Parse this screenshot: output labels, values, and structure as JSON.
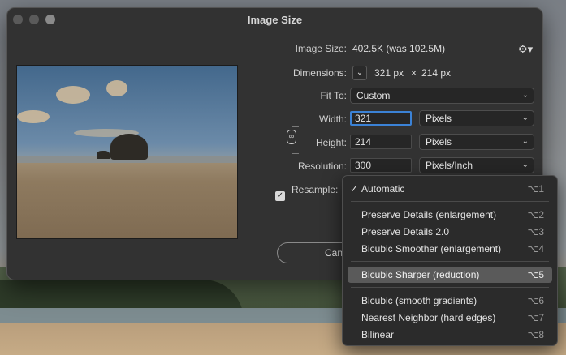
{
  "window": {
    "title": "Image Size"
  },
  "info": {
    "image_size_label": "Image Size:",
    "image_size_value": "402.5K (was 102.5M)",
    "dimensions_label": "Dimensions:",
    "dimensions_width": "321 px",
    "dimensions_times": "×",
    "dimensions_height": "214 px"
  },
  "fit_to": {
    "label": "Fit To:",
    "value": "Custom"
  },
  "width": {
    "label": "Width:",
    "value": "321",
    "unit": "Pixels"
  },
  "height": {
    "label": "Height:",
    "value": "214",
    "unit": "Pixels"
  },
  "resolution": {
    "label": "Resolution:",
    "value": "300",
    "unit": "Pixels/Inch"
  },
  "resample": {
    "label": "Resample:",
    "checked": true
  },
  "buttons": {
    "cancel_label": "Cancel"
  },
  "menu": {
    "items": [
      {
        "label": "Automatic",
        "shortcut": "⌥1",
        "checked": true
      },
      {
        "label": "Preserve Details (enlargement)",
        "shortcut": "⌥2"
      },
      {
        "label": "Preserve Details 2.0",
        "shortcut": "⌥3"
      },
      {
        "label": "Bicubic Smoother (enlargement)",
        "shortcut": "⌥4"
      },
      {
        "label": "Bicubic Sharper (reduction)",
        "shortcut": "⌥5",
        "highlighted": true
      },
      {
        "label": "Bicubic (smooth gradients)",
        "shortcut": "⌥6"
      },
      {
        "label": "Nearest Neighbor (hard edges)",
        "shortcut": "⌥7"
      },
      {
        "label": "Bilinear",
        "shortcut": "⌥8"
      }
    ]
  },
  "icons": {
    "gear": "gear-icon",
    "link": "chain-link-icon",
    "dimensions_toggle": "chevron-down-icon"
  },
  "colors": {
    "dialog_bg": "#323232",
    "focus": "#3b82d6",
    "highlight": "#5a5a5a"
  }
}
